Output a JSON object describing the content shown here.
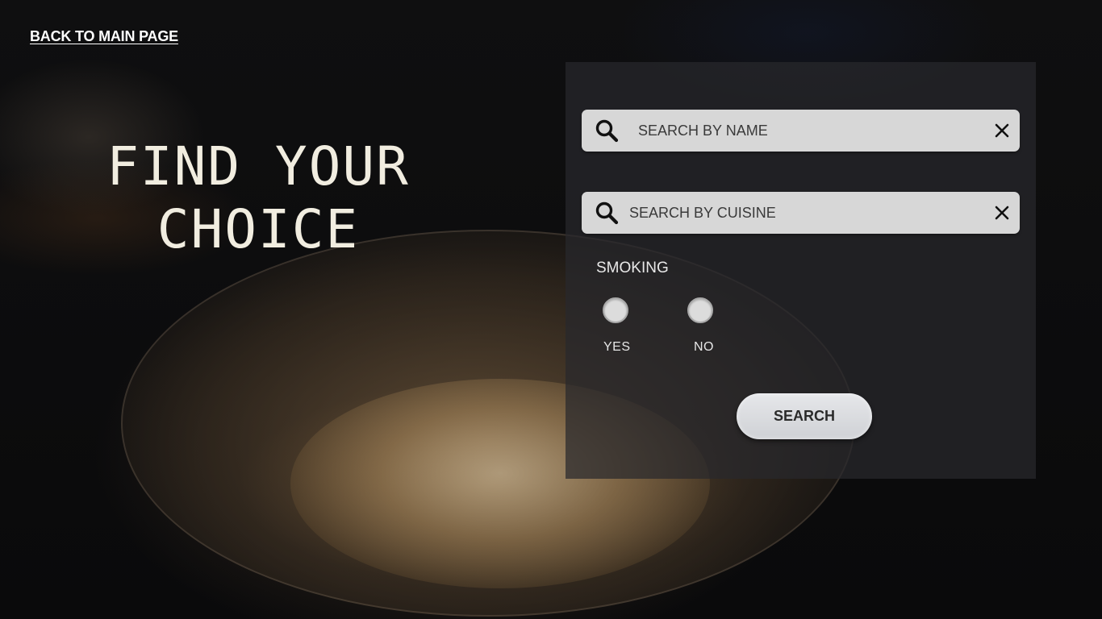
{
  "nav": {
    "back_label": "BACK TO MAIN PAGE"
  },
  "hero": {
    "title_line1": "FIND YOUR",
    "title_line2": "CHOICE"
  },
  "search": {
    "name_placeholder": "SEARCH BY NAME",
    "cuisine_placeholder": "SEARCH BY CUISINE"
  },
  "smoking": {
    "label": "SMOKING",
    "options": [
      {
        "label": "YES",
        "selected": false
      },
      {
        "label": "NO",
        "selected": false
      }
    ]
  },
  "actions": {
    "search_label": "SEARCH"
  },
  "icons": {
    "search": "search-icon",
    "clear": "close-icon"
  },
  "colors": {
    "panel_bg": "#28282c",
    "input_bg": "#d7d7d7",
    "title_color": "#f1ede0",
    "button_bg": "#dcdde0"
  }
}
